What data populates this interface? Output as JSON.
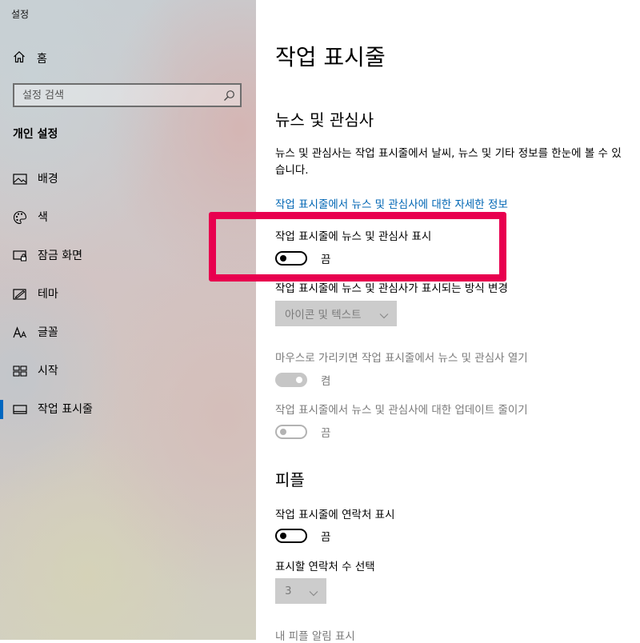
{
  "window": {
    "title": "설정"
  },
  "sidebar": {
    "home_label": "홈",
    "search_placeholder": "설정 검색",
    "section_title": "개인 설정",
    "items": [
      {
        "label": "배경",
        "icon": "picture-icon"
      },
      {
        "label": "색",
        "icon": "palette-icon"
      },
      {
        "label": "잠금 화면",
        "icon": "lock-screen-icon"
      },
      {
        "label": "테마",
        "icon": "theme-icon"
      },
      {
        "label": "글꼴",
        "icon": "font-icon"
      },
      {
        "label": "시작",
        "icon": "start-icon"
      },
      {
        "label": "작업 표시줄",
        "icon": "taskbar-icon",
        "selected": true
      }
    ]
  },
  "main": {
    "title": "작업 표시줄",
    "news_section": {
      "title": "뉴스 및 관심사",
      "description": "뉴스 및 관심사는 작업 표시줄에서 날씨, 뉴스 및 기타 정보를 한눈에 볼 수 있습니다.",
      "link": "작업 표시줄에서 뉴스 및 관심사에 대한 자세한 정보",
      "show_toggle": {
        "label": "작업 표시줄에 뉴스 및 관심사 표시",
        "state": "끔",
        "on": false
      },
      "display_mode": {
        "label": "작업 표시줄에 뉴스 및 관심사가 표시되는 방식 변경",
        "value": "아이콘 및 텍스트",
        "enabled": false
      },
      "hover_toggle": {
        "label": "마우스로 가리키면 작업 표시줄에서 뉴스 및 관심사 열기",
        "state": "켬",
        "on": true,
        "enabled": false
      },
      "reduce_toggle": {
        "label": "작업 표시줄에서 뉴스 및 관심사에 대한 업데이트 줄이기",
        "state": "끔",
        "on": false,
        "enabled": false
      }
    },
    "people_section": {
      "title": "피플",
      "contacts_toggle": {
        "label": "작업 표시줄에 연락처 표시",
        "state": "끔",
        "on": false
      },
      "count_select": {
        "label": "표시할 연락처 수 선택",
        "value": "3",
        "enabled": false
      },
      "notify_label": "내 피플 알림 표시"
    }
  },
  "colors": {
    "accent": "#0067c0",
    "link": "#0066b4",
    "highlight": "#e8004f",
    "disabled_text": "#7a7a7a",
    "disabled_fill": "#cccccc"
  }
}
